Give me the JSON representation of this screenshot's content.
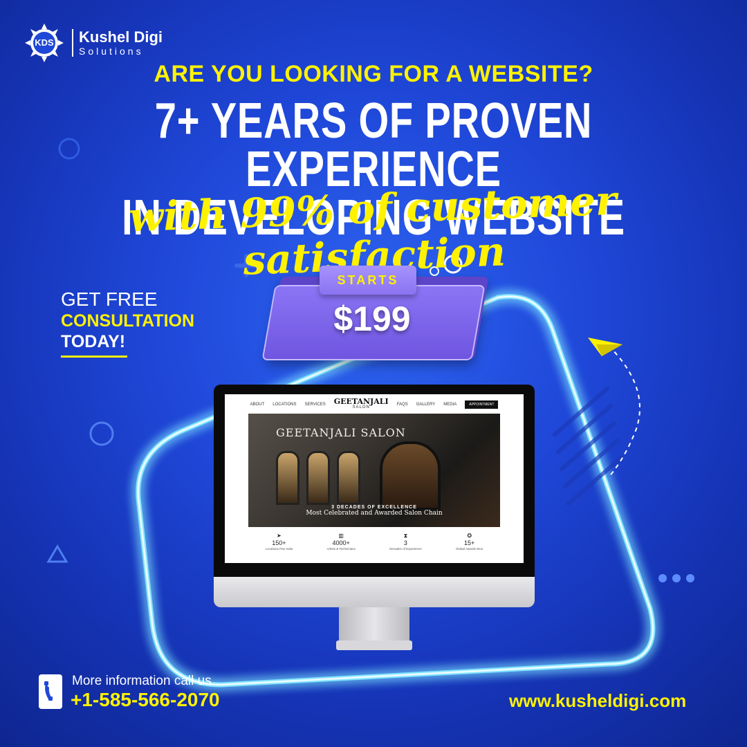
{
  "brand": {
    "logo_mark": "KDS",
    "name": "Kushel Digi",
    "sub": "Solutions"
  },
  "headline": {
    "question": "ARE YOU LOOKING FOR A WEBSITE?",
    "line1": "7+ YEARS OF PROVEN EXPERIENCE",
    "line2": "IN DEVELOPING WEBSITE",
    "script_line": "with 99% of customer satisfaction"
  },
  "consultation": {
    "line1": "GET FREE",
    "line2": "CONSULTATION",
    "line3": "TODAY!"
  },
  "price_badge": {
    "label": "STARTS",
    "price": "$199"
  },
  "screen": {
    "nav_left": [
      "ABOUT",
      "LOCATIONS",
      "SERVICES"
    ],
    "brand": "GEETANJALI",
    "brand_sub": "SALON",
    "nav_right": [
      "FAQS",
      "GALLERY",
      "MEDIA"
    ],
    "appointment": "APPOINTMENT",
    "hero_sign": "GEETANJALI SALON",
    "hero_caption1": "3 DECADES OF EXCELLENCE",
    "hero_caption2": "Most Celebrated and Awarded Salon Chain",
    "stats": [
      {
        "icon": "➤",
        "value": "150+",
        "label": "Locations Pan India"
      },
      {
        "icon": "▥",
        "value": "4000+",
        "label": "Artists & Technicians"
      },
      {
        "icon": "⧗",
        "value": "3",
        "label": "Decades of Experience"
      },
      {
        "icon": "✪",
        "value": "15+",
        "label": "Global Awards Won"
      }
    ]
  },
  "contact": {
    "label": "More information call us",
    "phone": "+1-585-566-2070",
    "website": "www.kusheldigi.com"
  },
  "colors": {
    "background": "#1f47d8",
    "accent_yellow": "#fff200",
    "badge_purple": "#7a60e8",
    "neon_glow": "#8fe9ff"
  }
}
